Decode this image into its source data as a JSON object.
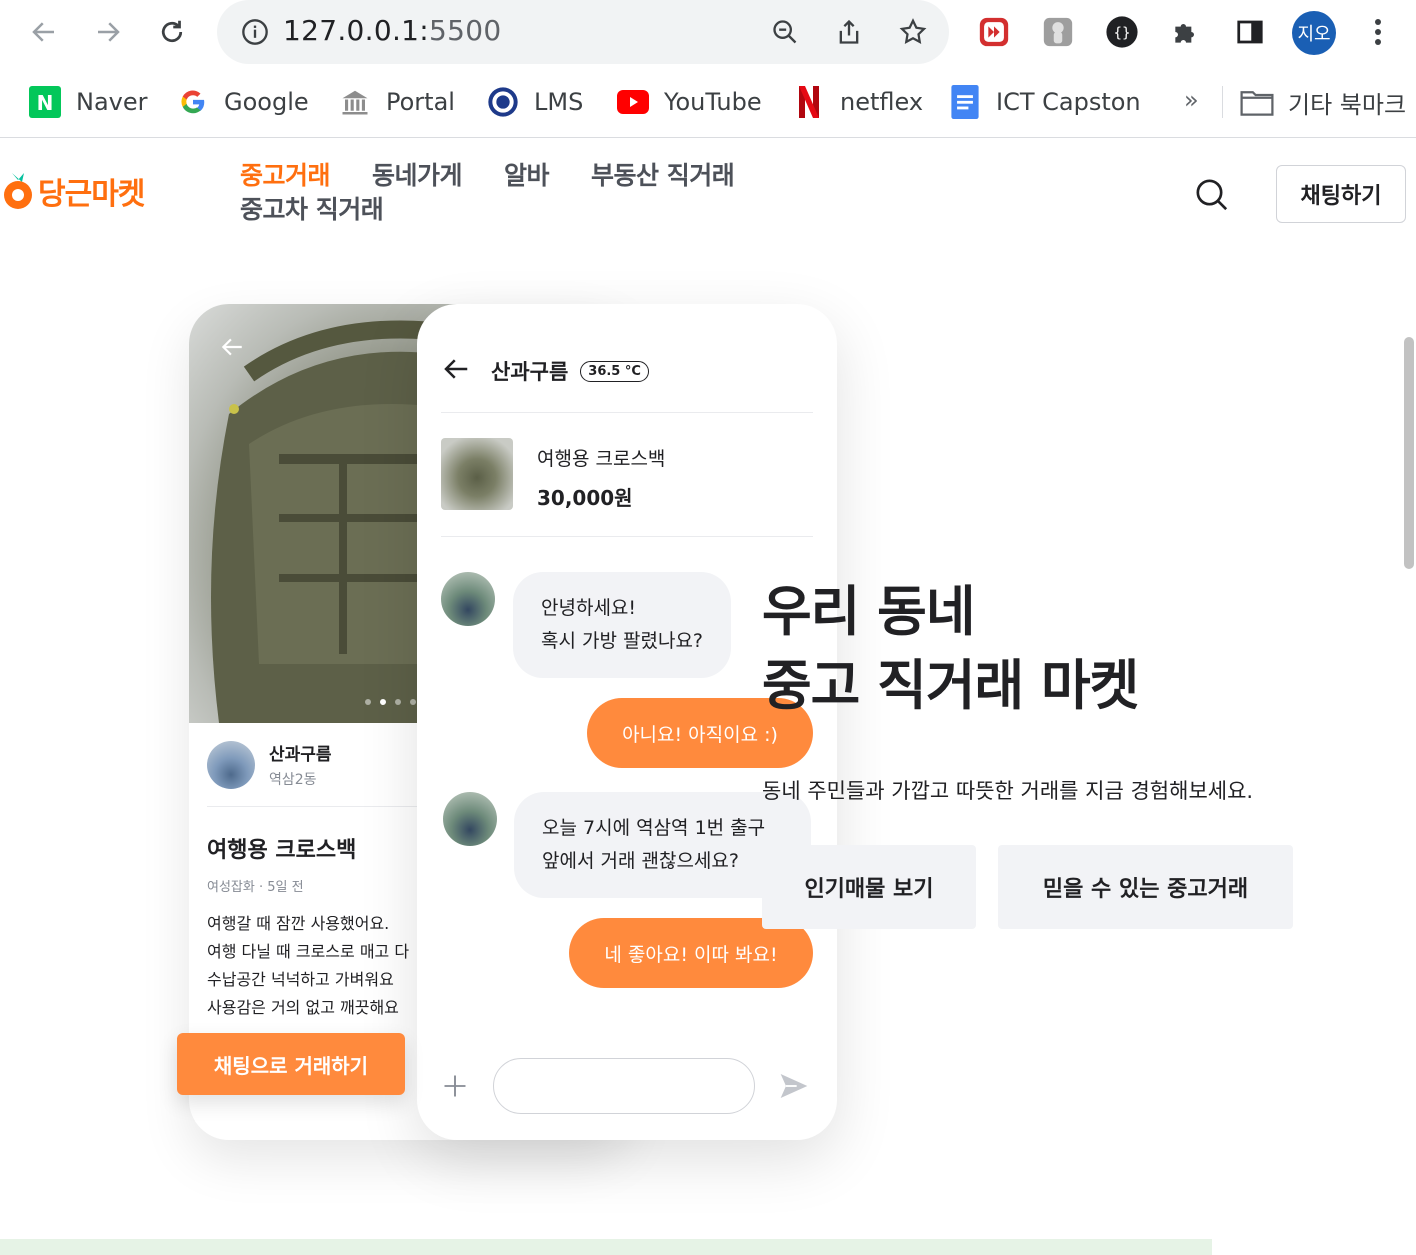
{
  "browser": {
    "url_host": "127.0.0.1:",
    "url_port": "5500",
    "profile_initials": "지오",
    "bookmarks": [
      {
        "label": "Naver",
        "icon": "naver-icon"
      },
      {
        "label": "Google",
        "icon": "google-icon"
      },
      {
        "label": "Portal",
        "icon": "portal-icon"
      },
      {
        "label": "LMS",
        "icon": "lms-icon"
      },
      {
        "label": "YouTube",
        "icon": "youtube-icon"
      },
      {
        "label": "netflex",
        "icon": "netflix-icon"
      },
      {
        "label": "ICT Capston",
        "icon": "docs-icon"
      }
    ],
    "bookmarks_more": "»",
    "other_bookmarks": "기타 북마크"
  },
  "site": {
    "logo_text": "당근마켓",
    "brand_color": "#ff6f0f",
    "nav": [
      "중고거래",
      "동네가게",
      "알바",
      "부동산 직거래",
      "중고차 직거래"
    ],
    "chat_button": "채팅하기"
  },
  "product_card": {
    "seller_name": "산과구름",
    "seller_location": "역삼2동",
    "title": "여행용 크로스백",
    "meta": "여성잡화 · 5일 전",
    "description": [
      "여행갈 때 잠깐 사용했어요.",
      "여행 다닐 때 크로스로 매고 다",
      "수납공간 넉넉하고 가벼워요",
      "사용감은 거의 없고 깨끗해요"
    ],
    "cta": "채팅으로 거래하기"
  },
  "chat_card": {
    "name": "산과구름",
    "temperature": "36.5 °C",
    "item_title": "여행용 크로스백",
    "item_price": "30,000원",
    "msg1_line1": "안녕하세요!",
    "msg1_line2": "혹시 가방 팔렸나요?",
    "reply1": "아니요! 아직이요 :)",
    "msg2_line1": "오늘 7시에 역삼역 1번 출구",
    "msg2_line2": "앞에서 거래 괜찮으세요?",
    "reply2": "네 좋아요! 이따 봐요!"
  },
  "hero": {
    "title_line1": "우리 동네",
    "title_line2": "중고 직거래 마켓",
    "subtitle": "동네 주민들과 가깝고 따뜻한 거래를 지금 경험해보세요.",
    "button1": "인기매물 보기",
    "button2": "믿을 수 있는 중고거래"
  },
  "colors": {
    "accent": "#ff8a3d",
    "muted_bg": "#f2f3f6"
  }
}
